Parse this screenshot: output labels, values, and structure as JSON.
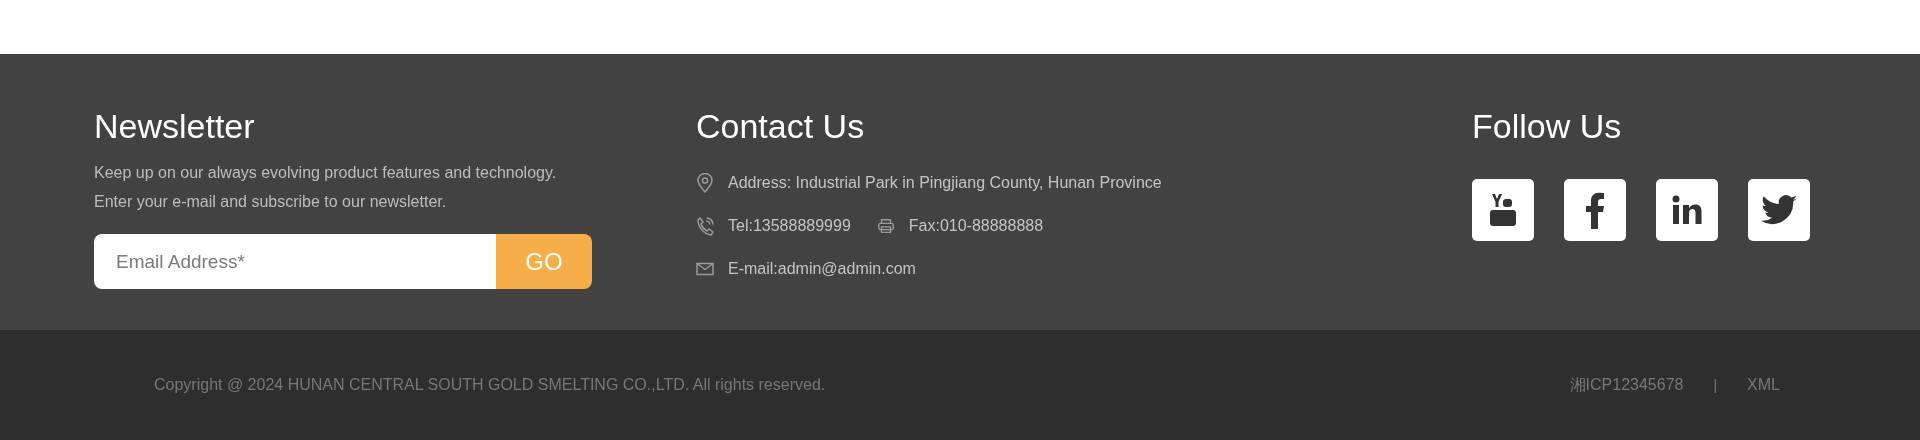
{
  "newsletter": {
    "title": "Newsletter",
    "description": [
      "Keep up on our always evolving product features and technology.",
      "Enter your e-mail and subscribe to our newsletter."
    ],
    "email_field": {
      "placeholder": "Email Address*"
    },
    "submit_button": "GO"
  },
  "contact": {
    "title": "Contact Us",
    "rows": [
      [
        {
          "kind": "address",
          "text": "Address: Industrial Park in Pingjiang County, Hunan Province"
        }
      ],
      [
        {
          "kind": "phone",
          "text": "Tel:13588889999"
        },
        {
          "kind": "fax",
          "text": "Fax:010-88888888"
        }
      ],
      [
        {
          "kind": "email",
          "text": "E-mail:admin@admin.com"
        }
      ]
    ]
  },
  "follow": {
    "title": "Follow Us",
    "links": [
      {
        "kind": "youtube"
      },
      {
        "kind": "facebook"
      },
      {
        "kind": "linkedin"
      },
      {
        "kind": "twitter"
      }
    ]
  },
  "bottom_bar": {
    "copyright": "Copyright @ 2024 HUNAN CENTRAL SOUTH GOLD SMELTING CO.,LTD. All rights reserved.",
    "icp": "湘ICP12345678",
    "separator": "|",
    "xml_link": "XML"
  }
}
